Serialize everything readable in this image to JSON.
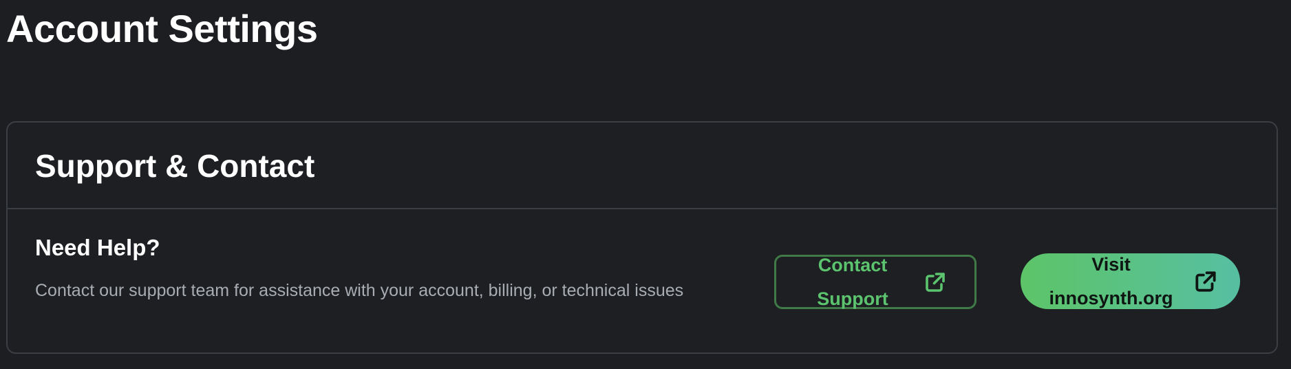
{
  "page": {
    "title": "Account Settings"
  },
  "support_card": {
    "title": "Support & Contact",
    "help_heading": "Need Help?",
    "help_text": "Contact our support team for assistance with your account, billing, or technical issues",
    "contact_button": {
      "label": "Contact Support",
      "icon": "external-link-icon",
      "color": "#5cc46e"
    },
    "visit_button": {
      "label": "Visit innosynth.org",
      "icon": "external-link-icon",
      "gradient_start": "#5dc468",
      "gradient_end": "#57bfa1"
    }
  }
}
